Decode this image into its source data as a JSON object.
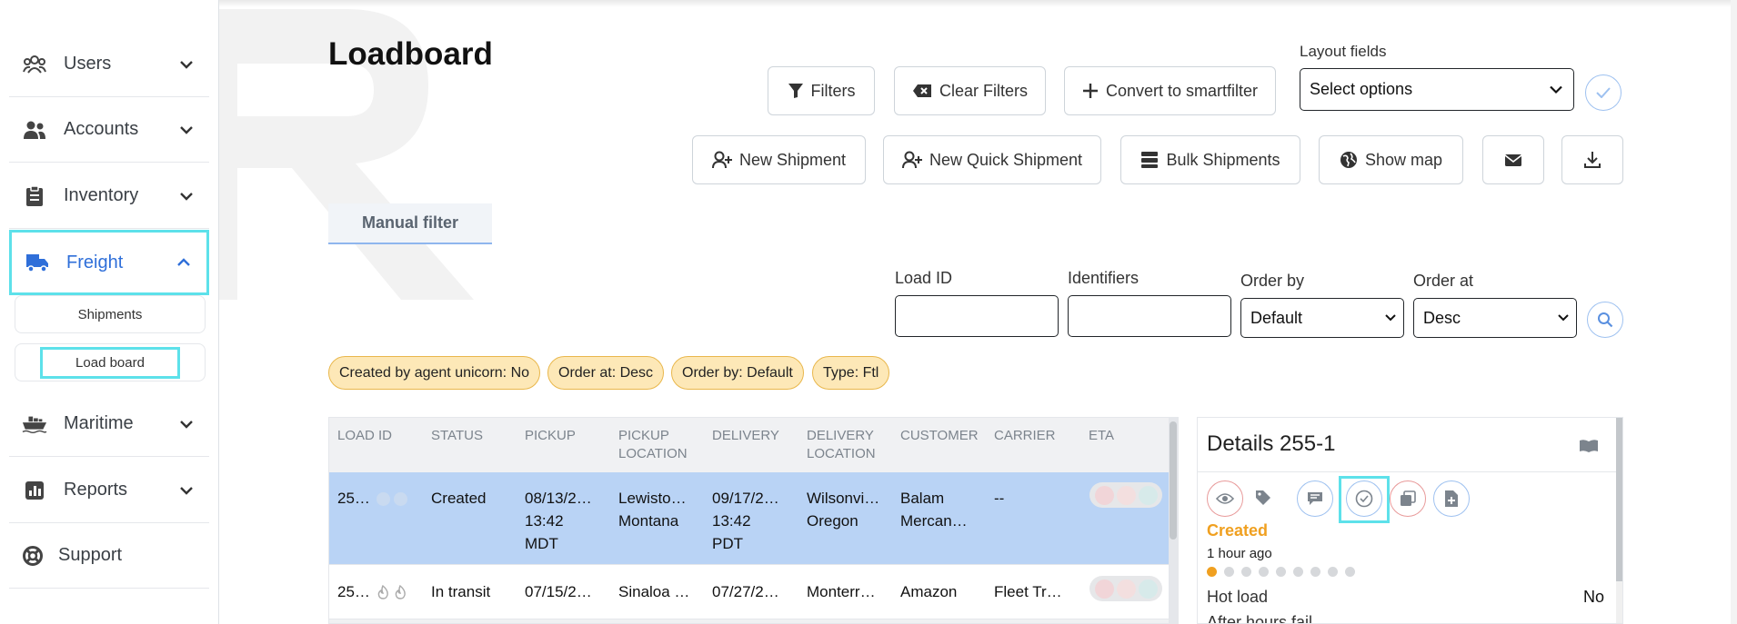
{
  "sidebar": {
    "items": [
      {
        "label": "Users",
        "icon": "users-icon"
      },
      {
        "label": "Accounts",
        "icon": "accounts-icon"
      },
      {
        "label": "Inventory",
        "icon": "clipboard-icon"
      },
      {
        "label": "Freight",
        "icon": "truck-icon",
        "active": true
      },
      {
        "label": "Maritime",
        "icon": "ship-icon"
      },
      {
        "label": "Reports",
        "icon": "chart-icon"
      },
      {
        "label": "Support",
        "icon": "lifebuoy-icon"
      }
    ],
    "freight_sub": [
      {
        "label": "Shipments"
      },
      {
        "label": "Load board",
        "active": true
      }
    ]
  },
  "header": {
    "title": "Loadboard",
    "filters_label": "Filters",
    "clear_filters_label": "Clear Filters",
    "convert_label": "Convert to smartfilter",
    "layout_fields_label": "Layout fields",
    "layout_fields_value": "Select options",
    "new_shipment_label": "New Shipment",
    "new_quick_shipment_label": "New Quick Shipment",
    "bulk_shipments_label": "Bulk Shipments",
    "show_map_label": "Show map"
  },
  "tabs": {
    "manual_filter": "Manual filter"
  },
  "filter_form": {
    "load_id_label": "Load ID",
    "load_id_value": "",
    "identifiers_label": "Identifiers",
    "identifiers_value": "",
    "order_by_label": "Order by",
    "order_by_value": "Default",
    "order_at_label": "Order at",
    "order_at_value": "Desc"
  },
  "chips": [
    "Created by agent unicorn: No",
    "Order at: Desc",
    "Order by: Default",
    "Type: Ftl"
  ],
  "table": {
    "columns": [
      "LOAD ID",
      "STATUS",
      "PICKUP",
      "PICKUP\nLOCATION",
      "DELIVERY",
      "DELIVERY\nLOCATION",
      "CUSTOMER",
      "CARRIER",
      "ETA"
    ],
    "rows": [
      {
        "load_id": "25…",
        "status": "Created",
        "pickup": "08/13/2…\n13:42\nMDT",
        "pickup_location": "Lewisto…\nMontana",
        "delivery": "09/17/2…\n13:42\nPDT",
        "delivery_location": "Wilsonvi…\nOregon",
        "customer": "Balam\nMercan…",
        "carrier": "--"
      },
      {
        "load_id": "25…",
        "status": "In transit",
        "pickup": "07/15/2…",
        "pickup_location": "Sinaloa …",
        "delivery": "07/27/2…",
        "delivery_location": "Monterr…",
        "customer": "Amazon",
        "carrier": "Fleet Tr…"
      }
    ]
  },
  "details": {
    "title": "Details 255-1",
    "status": "Created",
    "time_ago": "1 hour ago",
    "progress_total": 9,
    "progress_done": 1,
    "hot_load_label": "Hot load",
    "hot_load_value": "No",
    "next_label": "After hours fail"
  },
  "colors": {
    "accent": "#2f6fd9",
    "highlight": "#5de1ea",
    "chip_bg": "#fde8b7",
    "selected_row": "#b9d3f5",
    "status_created": "#f0a020"
  }
}
